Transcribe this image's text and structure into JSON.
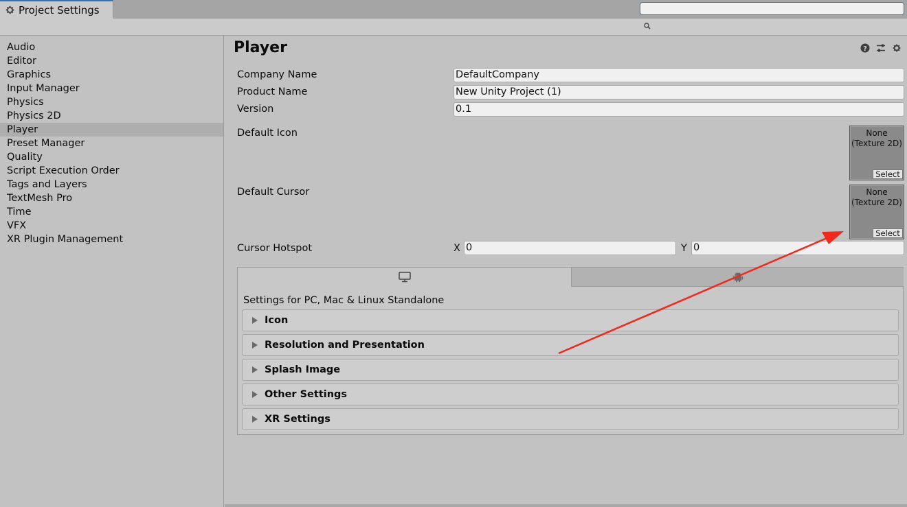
{
  "window": {
    "tab_title": "Project Settings",
    "controls": [
      "more-icon",
      "maximize-icon",
      "close-icon"
    ]
  },
  "search": {
    "value": "",
    "placeholder": ""
  },
  "sidebar": {
    "items": [
      {
        "label": "Audio"
      },
      {
        "label": "Editor"
      },
      {
        "label": "Graphics"
      },
      {
        "label": "Input Manager"
      },
      {
        "label": "Physics"
      },
      {
        "label": "Physics 2D"
      },
      {
        "label": "Player",
        "selected": true
      },
      {
        "label": "Preset Manager"
      },
      {
        "label": "Quality"
      },
      {
        "label": "Script Execution Order"
      },
      {
        "label": "Tags and Layers"
      },
      {
        "label": "TextMesh Pro"
      },
      {
        "label": "Time"
      },
      {
        "label": "VFX"
      },
      {
        "label": "XR Plugin Management"
      }
    ]
  },
  "main": {
    "title": "Player",
    "header_icons": [
      "help-icon",
      "sliders-icon",
      "gear-icon"
    ],
    "company_name": {
      "label": "Company Name",
      "value": "DefaultCompany"
    },
    "product_name": {
      "label": "Product Name",
      "value": "New Unity Project (1)"
    },
    "version": {
      "label": "Version",
      "value": "0.1"
    },
    "default_icon": {
      "label": "Default Icon",
      "slot_line1": "None",
      "slot_line2": "(Texture 2D)",
      "select": "Select"
    },
    "default_cursor": {
      "label": "Default Cursor",
      "slot_line1": "None",
      "slot_line2": "(Texture 2D)",
      "select": "Select"
    },
    "cursor_hotspot": {
      "label": "Cursor Hotspot",
      "x_label": "X",
      "x_value": "0",
      "y_label": "Y",
      "y_value": "0"
    },
    "platform": {
      "tabs": [
        {
          "icon": "monitor-icon",
          "active": true
        },
        {
          "icon": "android-icon",
          "active": false
        }
      ],
      "label": "Settings for PC, Mac & Linux Standalone",
      "sections": [
        {
          "label": "Icon"
        },
        {
          "label": "Resolution and Presentation"
        },
        {
          "label": "Splash Image"
        },
        {
          "label": "Other Settings"
        },
        {
          "label": "XR Settings"
        }
      ]
    }
  },
  "colors": {
    "accent": "#3a72b0",
    "annotation_arrow": "#f2281a"
  }
}
